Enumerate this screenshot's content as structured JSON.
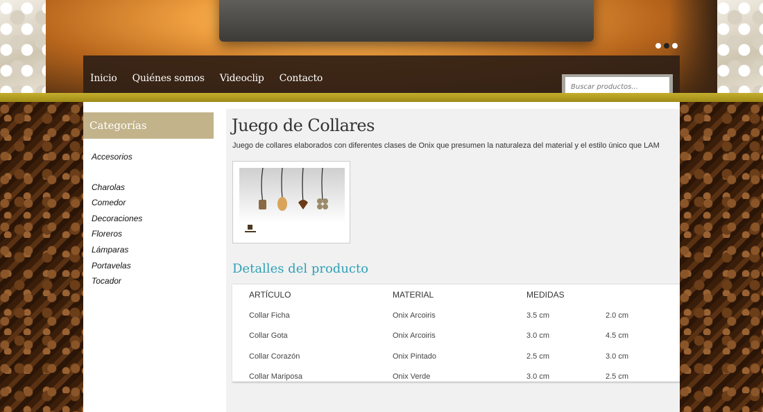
{
  "nav": {
    "items": [
      {
        "label": "Inicio"
      },
      {
        "label": "Quiénes somos"
      },
      {
        "label": "Videoclip"
      },
      {
        "label": "Contacto"
      }
    ]
  },
  "search": {
    "placeholder": "Buscar productos..."
  },
  "slider": {
    "dots": 3,
    "active_index": 1
  },
  "sidebar": {
    "title": "Categorías",
    "items": [
      {
        "label": "Accesorios"
      },
      {
        "label": "Charolas"
      },
      {
        "label": "Comedor"
      },
      {
        "label": "Decoraciones"
      },
      {
        "label": "Floreros"
      },
      {
        "label": "Lámparas"
      },
      {
        "label": "Portavelas"
      },
      {
        "label": "Tocador"
      }
    ]
  },
  "product": {
    "title": "Juego de Collares",
    "description": "Juego de collares elaborados con diferentes clases de Onix que presumen la naturaleza del material y el estilo único que LAM"
  },
  "details": {
    "title": "Detalles del producto",
    "headers": [
      "ARTÍCULO",
      "MATERIAL",
      "MEDIDAS",
      ""
    ],
    "rows": [
      [
        "Collar Ficha",
        "Onix Arcoiris",
        "3.5 cm",
        "2.0 cm"
      ],
      [
        "Collar Gota",
        "Onix Arcoiris",
        "3.0 cm",
        "4.5 cm"
      ],
      [
        "Collar Corazón",
        "Onix Pintado",
        "2.5 cm",
        "3.0 cm"
      ],
      [
        "Collar Mariposa",
        "Onix Verde",
        "3.0 cm",
        "2.5 cm"
      ]
    ]
  },
  "colors": {
    "accent_gold": "#c4ae2c",
    "category_header": "#c2b38a",
    "details_title": "#2ea0b6",
    "nav_bg": "#302016"
  }
}
